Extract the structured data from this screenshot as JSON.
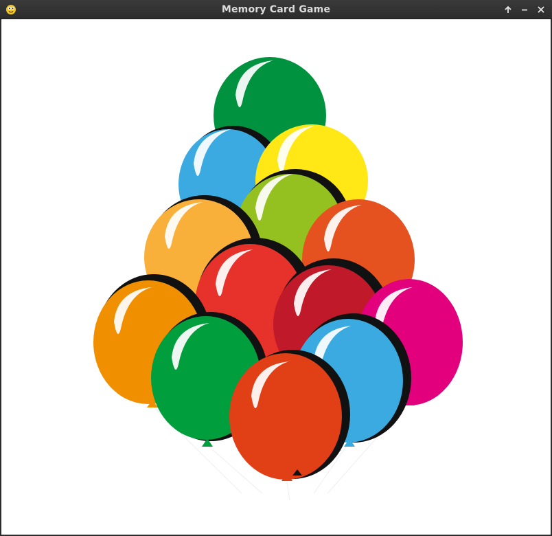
{
  "window": {
    "title": "Memory Card Game",
    "app_icon": "python-snake-icon",
    "controls": [
      {
        "name": "maximize-button",
        "icon": "arrow-up-icon"
      },
      {
        "name": "minimize-button",
        "icon": "minus-icon"
      },
      {
        "name": "close-button",
        "icon": "close-icon"
      }
    ]
  },
  "canvas": {
    "content": "balloon-bunch-image",
    "background": "#ffffff",
    "balloon_colors": [
      "#00923f",
      "#3aaae1",
      "#ffe816",
      "#94c11f",
      "#f9b03a",
      "#e6521f",
      "#e6322b",
      "#f08f00",
      "#c0192a",
      "#e3007d",
      "#009e3d",
      "#e13f16"
    ]
  }
}
